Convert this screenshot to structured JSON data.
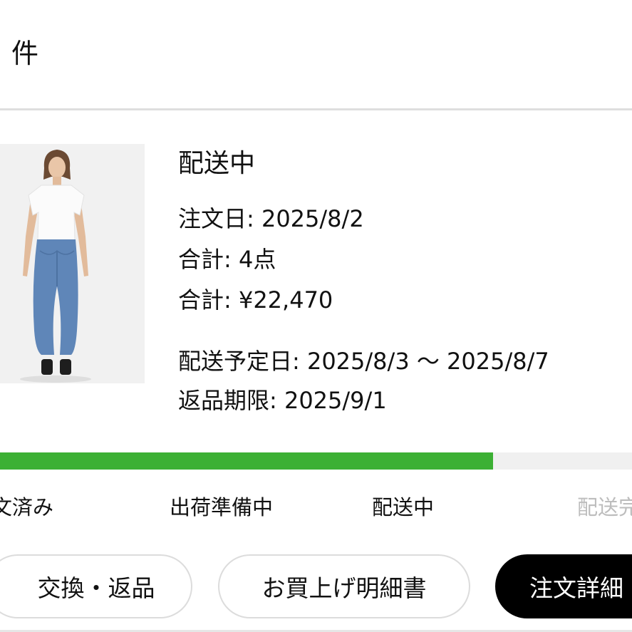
{
  "header": {
    "count_label": "件"
  },
  "order": {
    "status": "配送中",
    "order_date": "注文日: 2025/8/2",
    "item_count": "合計: 4点",
    "total_price": "合計: ¥22,470",
    "delivery_estimate": "配送予定日: 2025/8/3 〜 2025/8/7",
    "return_deadline": "返品期限: 2025/9/1",
    "product_image_icon": "product-photo-woman-denim"
  },
  "progress": {
    "fraction": 0.78,
    "color": "#3cb034",
    "steps": [
      {
        "label": "文済み"
      },
      {
        "label": "出荷準備中"
      },
      {
        "label": "配送中"
      },
      {
        "label": "配送完"
      }
    ]
  },
  "actions": {
    "exchange_return": "交換・返品",
    "receipt": "お買上げ明細書",
    "order_details": "注文詳細"
  }
}
